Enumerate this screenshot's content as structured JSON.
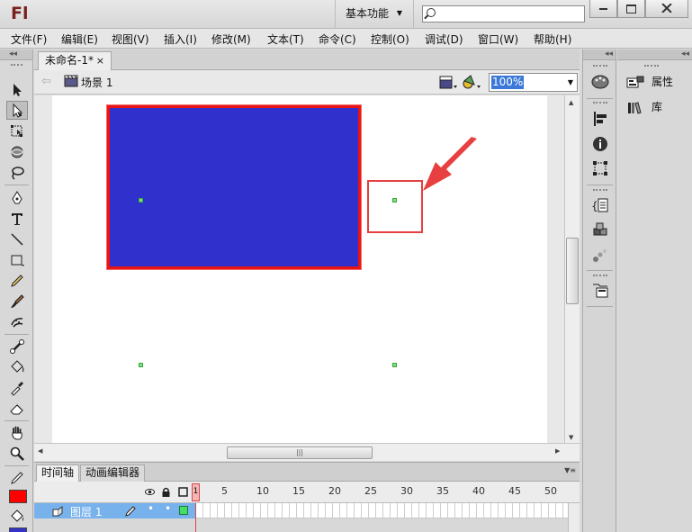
{
  "app": {
    "logo": "Fl",
    "workspace": "基本功能",
    "search": {
      "value": "",
      "placeholder": ""
    }
  },
  "menu": [
    "文件(F)",
    "编辑(E)",
    "视图(V)",
    "插入(I)",
    "修改(M)",
    "文本(T)",
    "命令(C)",
    "控制(O)",
    "调试(D)",
    "窗口(W)",
    "帮助(H)"
  ],
  "document": {
    "tab_title": "未命名-1*",
    "tab_close": "×",
    "scene": "场景 1",
    "zoom": "100%"
  },
  "stage": {
    "rectangle": {
      "fill": "#3030cc",
      "stroke": "#ea1414"
    },
    "annotation_color": "#e64040"
  },
  "timeline": {
    "tabs": [
      "时间轴",
      "动画编辑器"
    ],
    "current_frame": "1",
    "ruler": [
      "5",
      "10",
      "15",
      "20",
      "25",
      "30",
      "35",
      "40",
      "45",
      "50"
    ],
    "layer": {
      "name": "图层 1",
      "icon": "layer-icon",
      "row_color": "#78b2ec"
    }
  },
  "colors": {
    "stroke": "#ff0000",
    "fill": "#3333cc"
  },
  "panels": {
    "properties": "属性",
    "library": "库"
  },
  "icons": [
    "selection-tool-icon",
    "subselection-tool-icon",
    "free-transform-icon",
    "3d-rotation-icon",
    "lasso-icon",
    "pen-icon",
    "text-icon",
    "line-icon",
    "rectangle-icon",
    "pencil-icon",
    "brush-icon",
    "deco-icon",
    "bone-icon",
    "paint-bucket-icon",
    "eyedropper-icon",
    "eraser-icon",
    "hand-icon",
    "zoom-icon"
  ]
}
